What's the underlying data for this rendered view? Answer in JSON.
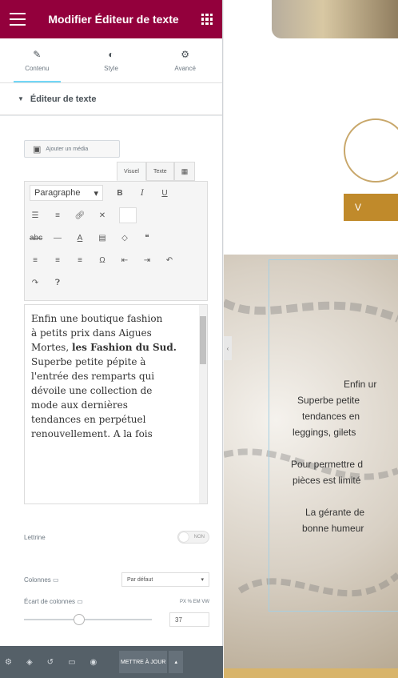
{
  "topbar": {
    "title": "Modifier Éditeur de texte"
  },
  "tabs": [
    {
      "label": "Contenu",
      "icon": "pencil-icon"
    },
    {
      "label": "Style",
      "icon": "contrast-icon"
    },
    {
      "label": "Avancé",
      "icon": "gear-icon"
    }
  ],
  "section": {
    "title": "Éditeur de texte"
  },
  "editor": {
    "add_media": "Ajouter un média",
    "tab_visual": "Visuel",
    "tab_text": "Texte",
    "format_select": "Paragraphe",
    "content": {
      "line1": "Enfin une boutique fashion",
      "line2": "à petits prix dans Aigues",
      "line3": "Mortes,",
      "bold": "les Fashion du Sud.",
      "line4": "Superbe petite pépite à",
      "line5": "l'entrée des remparts qui",
      "line6": "dévoile une collection de",
      "line7": "mode aux dernières",
      "line8": "tendances en perpétuel",
      "line9": "renouvellement. A la fois"
    }
  },
  "drop_cap": {
    "label": "Lettrine",
    "state": "NON"
  },
  "columns": {
    "label": "Colonnes",
    "value": "Par défaut"
  },
  "column_gap": {
    "label": "Écart de colonnes",
    "units": "PX % EM VW",
    "value": "37"
  },
  "footer": {
    "update_label": "METTRE À JOUR"
  },
  "preview": {
    "shop_button": "V",
    "lines": [
      "Enfin ur",
      "Superbe petite",
      "tendances en",
      "leggings, gilets",
      "",
      "Pour permettre d",
      "pièces est limité",
      "",
      "La gérante de",
      "bonne humeur"
    ]
  },
  "colors": {
    "brand": "#93003c",
    "footer": "#556068",
    "gold": "#c08a2b"
  }
}
